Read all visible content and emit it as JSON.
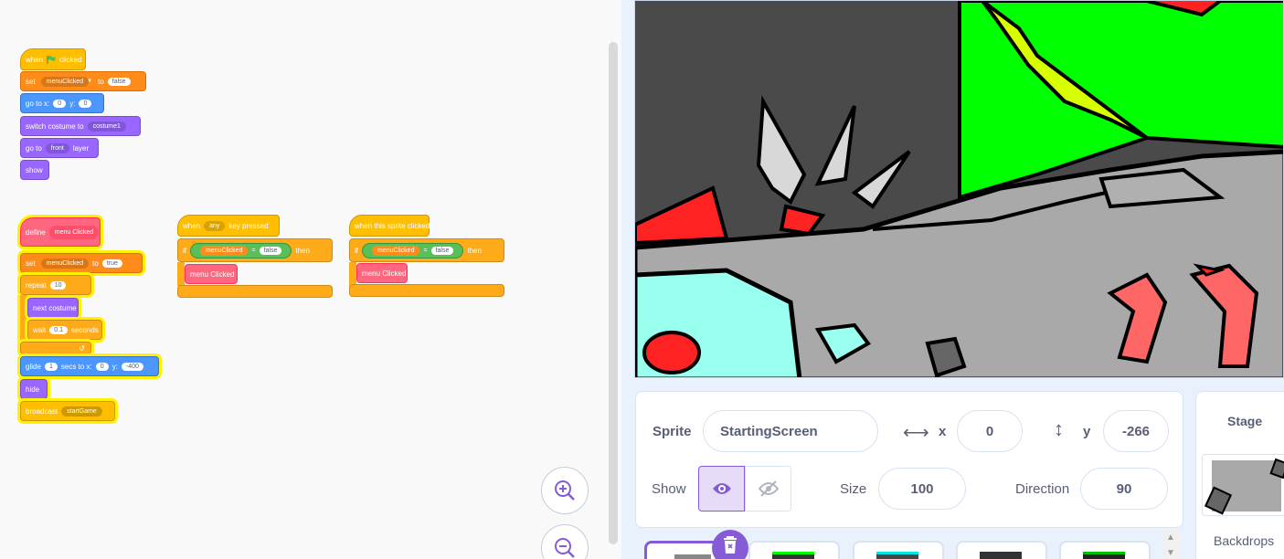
{
  "blocks": {
    "green_flag_script": {
      "when": "when",
      "clicked": "clicked",
      "set": "set",
      "var_name": "menuClicked",
      "to": "to",
      "set_value": "false",
      "goto_x_label": "go to x:",
      "x_value": "0",
      "y_label": "y:",
      "y_value": "0",
      "switch_costume": "switch costume to",
      "costume_value": "costume1",
      "go_to": "go to",
      "layer_value": "front",
      "layer": "layer",
      "show": "show"
    },
    "define_script": {
      "define": "define",
      "proc_name": "menu Clicked",
      "set": "set",
      "var_name": "menuClicked",
      "to": "to",
      "set_value": "true",
      "repeat": "repeat",
      "repeat_value": "10",
      "next_costume": "next costume",
      "wait": "wait",
      "wait_value": "0.1",
      "seconds": "seconds",
      "glide": "glide",
      "glide_secs": "1",
      "secs_to_x": "secs to x:",
      "glide_x": "0",
      "y_label": "y:",
      "glide_y": "-400",
      "hide": "hide",
      "broadcast": "broadcast",
      "message": "startGame"
    },
    "key_script": {
      "when": "when",
      "key": "any",
      "key_pressed": "key pressed",
      "if": "if",
      "var_name": "menuClicked",
      "equals": "=",
      "compare_value": "false",
      "then": "then",
      "call": "menu Clicked"
    },
    "sprite_click_script": {
      "hat": "when this sprite clicked",
      "if": "if",
      "var_name": "menuClicked",
      "equals": "=",
      "compare_value": "false",
      "then": "then",
      "call": "menu Clicked"
    }
  },
  "sprite_info": {
    "sprite_label": "Sprite",
    "sprite_name": "StartingScreen",
    "x_label": "x",
    "x_value": "0",
    "y_label": "y",
    "y_value": "-266",
    "show_label": "Show",
    "size_label": "Size",
    "size_value": "100",
    "direction_label": "Direction",
    "direction_value": "90"
  },
  "stage_pane": {
    "title": "Stage",
    "backdrops_label": "Backdrops"
  },
  "colors": {
    "events": "#ffbf00",
    "variables": "#ff8c1a",
    "motion": "#4c97ff",
    "looks": "#9966ff",
    "control": "#ffab19",
    "my_blocks": "#ff6680",
    "operators": "#59c059",
    "accent": "#855cd6"
  },
  "icons": [
    "green-flag-icon",
    "zoom-in-icon",
    "zoom-out-icon",
    "x-arrow-icon",
    "y-arrow-icon",
    "eye-icon",
    "eye-off-icon",
    "trash-icon",
    "loop-arrow-icon",
    "scroll-up-icon"
  ]
}
